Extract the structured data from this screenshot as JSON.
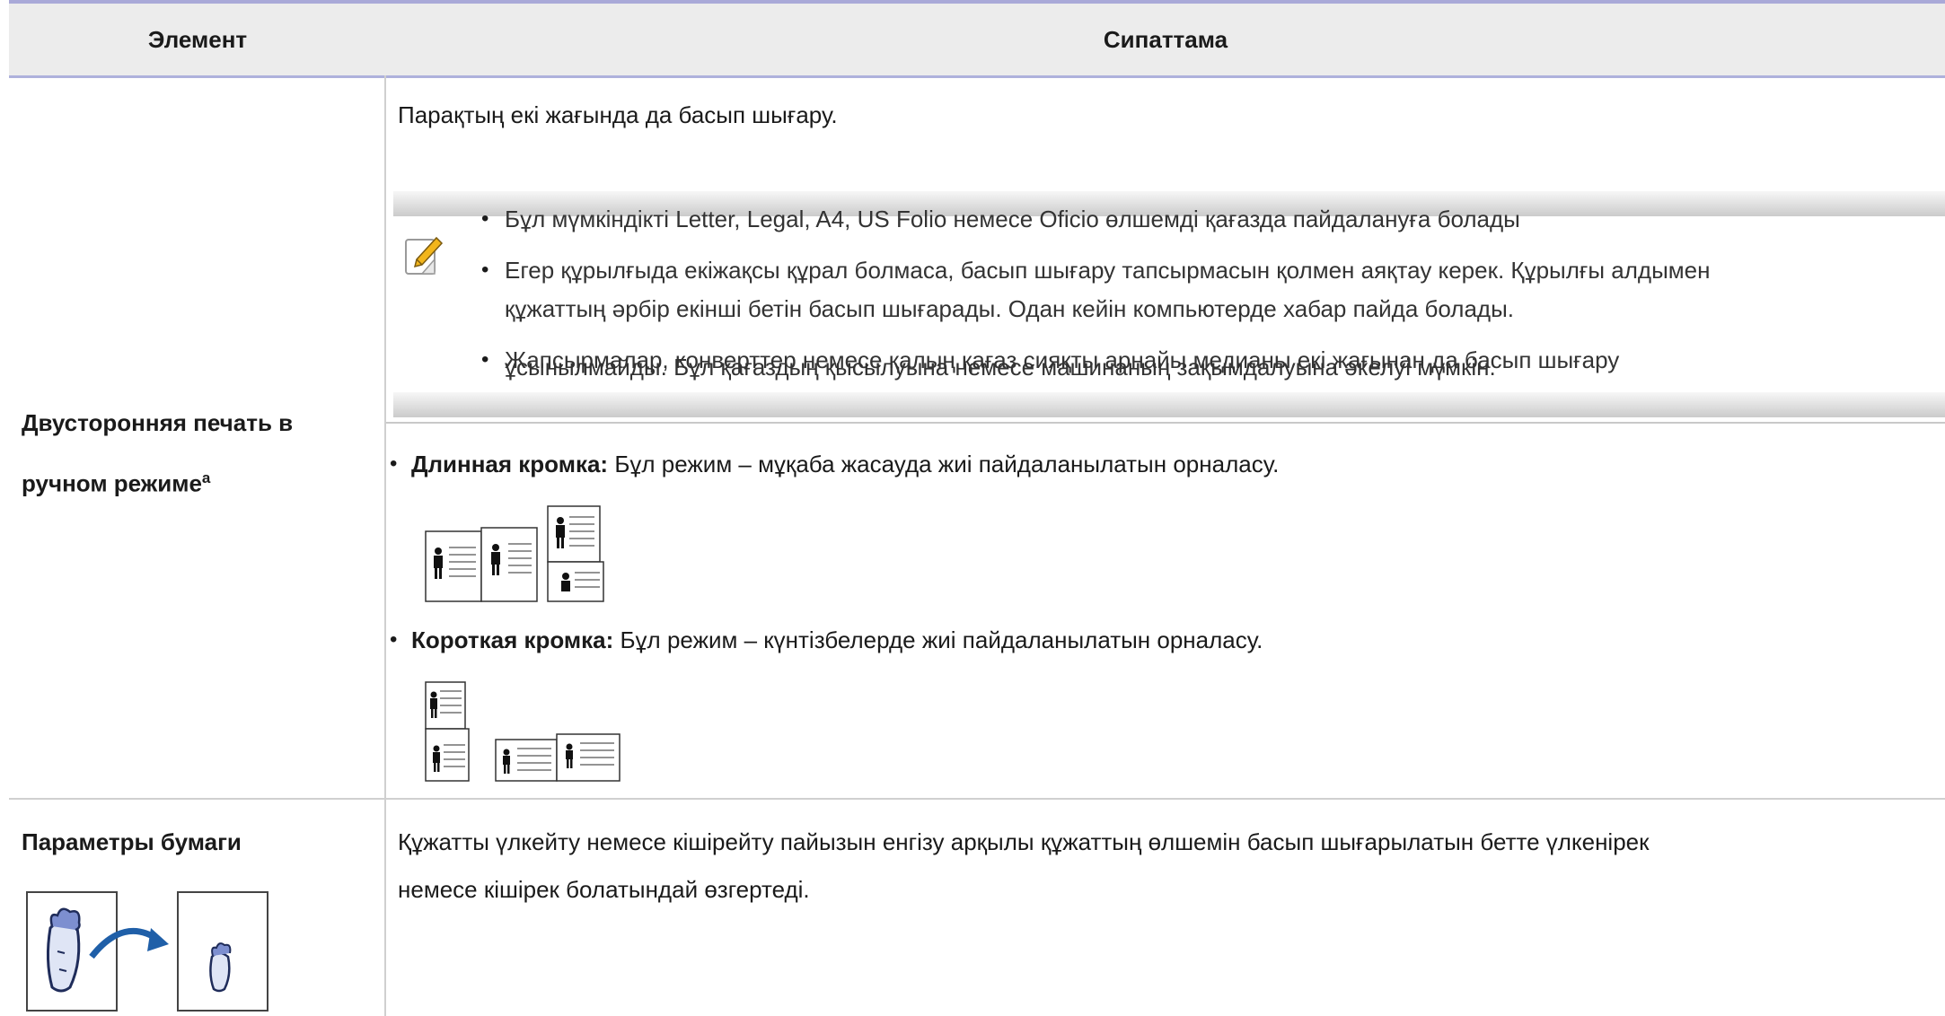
{
  "table": {
    "header": {
      "col_element": "Элемент",
      "col_description": "Сипаттама"
    },
    "row1": {
      "element_label": "Двусторонняя печать в",
      "element_label_line2": "ручном режиме",
      "element_sup": "a",
      "intro": "Парақтың екі жағында да басып шығару.",
      "note_bullets": [
        "Бұл мүмкіндікті Letter, Legal, A4, US Folio немесе Oficio өлшемді қағазда пайдалануға болады",
        "Егер құрылғыда екіжақсы құрал болмаса, басып шығару тапсырмасын қолмен аяқтау керек. Құрылғы алдымен",
        "құжаттың әрбір екінші бетін басып шығарады. Одан кейін компьютерде хабар пайда болады.",
        "Жапсырмалар, конверттер немесе қалың қағаз сияқты арнайы медианы екі жағынан да басып шығару",
        "ұсынылмайды. Бұл қағаздың қысылуына немесе машинаның зақымдалуына әкелуі мүмкін."
      ],
      "options": [
        {
          "term": "Длинная кромка:",
          "text": " Бұл режим – мұқаба жасауда жиі пайдаланылатын орналасу."
        },
        {
          "term": "Короткая кромка:",
          "text": " Бұл режим – күнтізбелерде жиі пайдаланылатын орналасу."
        }
      ],
      "bullet_char": "•"
    },
    "row2": {
      "element_label": "Параметры бумаги",
      "desc_line1": "Құжатты үлкейту немесе кішірейту пайызын енгізу арқылы құжаттың өлшемін басып шығарылатын бетте үлкенірек",
      "desc_line2": "немесе кішірек болатындай өзгертеді."
    }
  },
  "icons": {
    "note_icon": "pencil-note-icon",
    "long_edge_illustration": "long-edge-binding-icon",
    "short_edge_illustration": "short-edge-binding-icon",
    "scaling_illustration": "page-scaling-icon"
  },
  "colors": {
    "header_bg": "#ececec",
    "header_rule": "#aeb1dc",
    "grid": "#d0d0d0",
    "note_icon_accent": "#f2b51b",
    "arrow": "#1f5fa8"
  }
}
